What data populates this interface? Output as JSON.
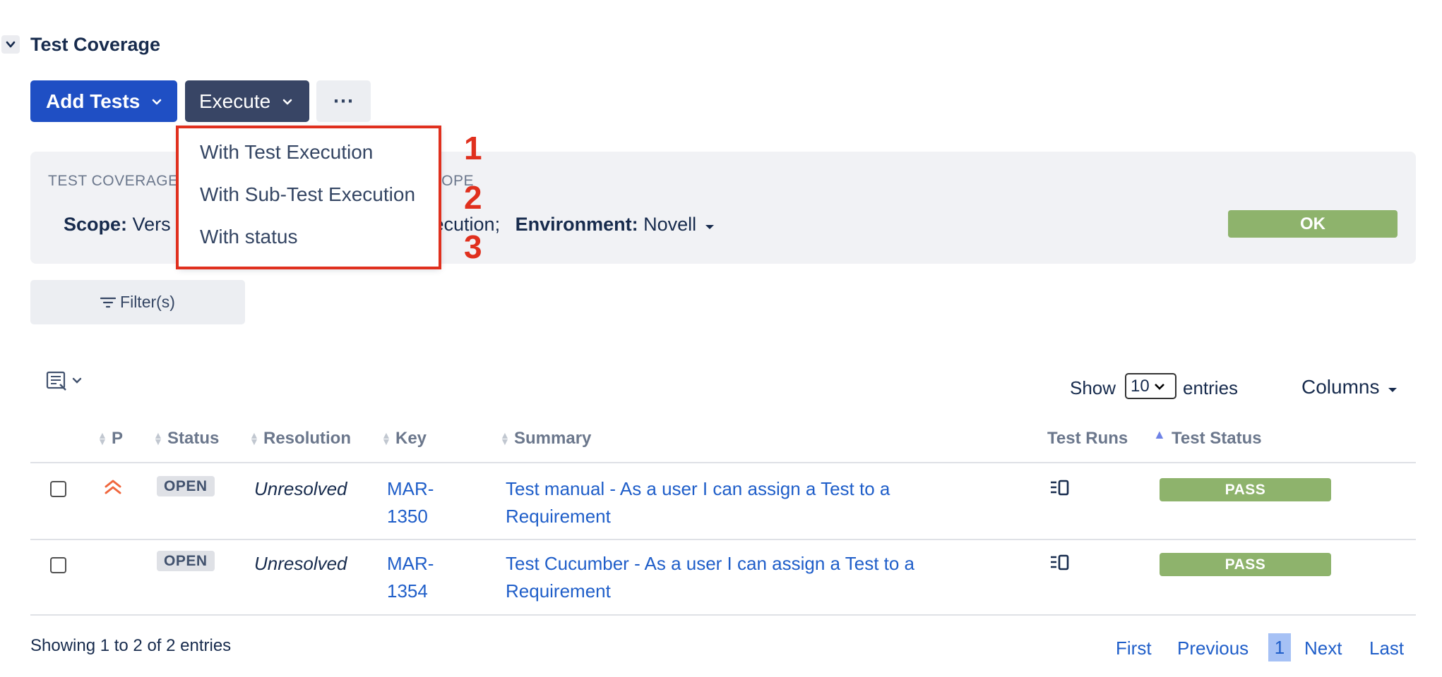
{
  "section": {
    "title": "Test Coverage"
  },
  "toolbar": {
    "add_tests_label": "Add Tests",
    "execute_label": "Execute",
    "more_label": "⋯"
  },
  "coverage_panel": {
    "label_left": "TEST COVERAGE",
    "label_right": "SCOPE",
    "scope_label": "Scope:",
    "scope_value_partial": "Vers",
    "scope_value_tail": "xecution;",
    "environment_label": "Environment:",
    "environment_value": "Novell",
    "status_badge": "OK"
  },
  "execute_menu": {
    "items": [
      {
        "label": "With Test Execution",
        "callout": "1"
      },
      {
        "label": "With Sub-Test Execution",
        "callout": "2"
      },
      {
        "label": "With status",
        "callout": "3"
      }
    ]
  },
  "filter": {
    "label": "Filter(s)"
  },
  "table_controls": {
    "show_label": "Show",
    "page_size": "10",
    "entries_label": "entries",
    "columns_label": "Columns"
  },
  "table": {
    "headers": {
      "priority": "P",
      "status": "Status",
      "resolution": "Resolution",
      "key": "Key",
      "summary": "Summary",
      "test_runs": "Test Runs",
      "test_status": "Test Status"
    },
    "rows": [
      {
        "priority_icon": "priority-highest-icon",
        "status": "OPEN",
        "resolution": "Unresolved",
        "key_line1": "MAR-",
        "key_line2": "1350",
        "summary_line1": "Test manual - As a user I can assign a Test to a",
        "summary_line2": "Requirement",
        "test_runs_icon": "☰†",
        "test_status": "PASS"
      },
      {
        "priority_icon": "",
        "status": "OPEN",
        "resolution": "Unresolved",
        "key_line1": "MAR-",
        "key_line2": "1354",
        "summary_line1": "Test Cucumber - As a user I can assign a Test to a",
        "summary_line2": "Requirement",
        "test_runs_icon": "☰†",
        "test_status": "PASS"
      }
    ]
  },
  "footer": {
    "showing_text": "Showing 1 to 2 of 2 entries",
    "first": "First",
    "previous": "Previous",
    "current_page": "1",
    "next": "Next",
    "last": "Last"
  },
  "colors": {
    "primary_button": "#1f4fc4",
    "execute_button": "#384565",
    "pass_badge": "#8eb36c",
    "highlight_annotation": "#e0301e",
    "link": "#1f5ec9"
  }
}
